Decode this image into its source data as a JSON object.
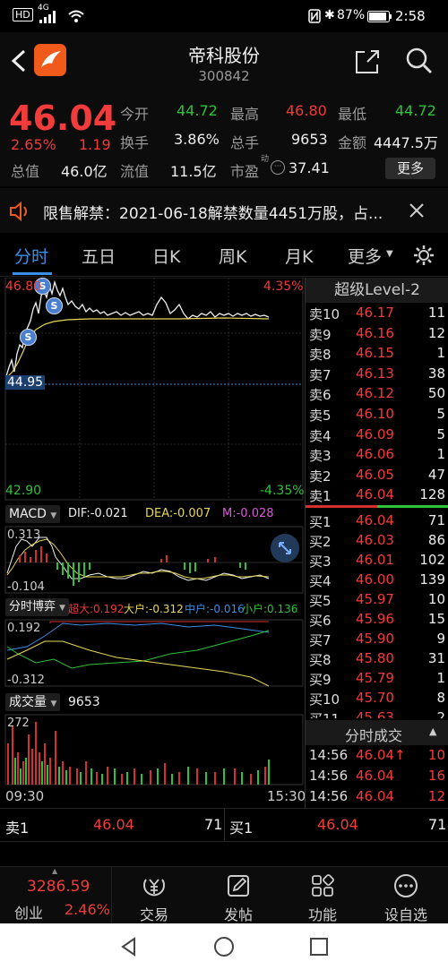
{
  "status_bar": {
    "carrier_hd": "HD",
    "signal": "4G",
    "battery": "87%",
    "time": "2:58"
  },
  "header": {
    "stock_name": "帝科股份",
    "stock_code": "300842"
  },
  "quote": {
    "price": "46.04",
    "change_pct": "2.65%",
    "change_amt": "1.19",
    "open_label": "今开",
    "open": "44.72",
    "high_label": "最高",
    "high": "46.80",
    "low_label": "最低",
    "low": "44.72",
    "turnover_label": "换手",
    "turnover": "3.86%",
    "volume_label": "总手",
    "volume": "9653",
    "amount_label": "金额",
    "amount": "4447.5万",
    "mktcap_label": "总值",
    "mktcap": "46.0亿",
    "float_label": "流值",
    "float_cap": "11.5亿",
    "pe_label": "市盈",
    "pe_sup": "动",
    "pe": "37.41",
    "more_label": "更多"
  },
  "notice": {
    "text": "限售解禁：2021-06-18解禁数量4451万股，占..."
  },
  "tabs": [
    "分时",
    "五日",
    "日K",
    "周K",
    "月K",
    "更多"
  ],
  "chart": {
    "high_price": "46.80",
    "high_pct": "4.35%",
    "low_price": "42.90",
    "low_pct": "-4.35%",
    "avg_line_price": "44.95",
    "macd": {
      "title": "MACD",
      "dif": "DIF:-0.021",
      "dea": "DEA:-0.007",
      "m": "M:-0.028",
      "top": "0.313",
      "bottom": "-0.104"
    },
    "flow": {
      "title": "分时博弈",
      "super": "超大:0.192",
      "large": "大户:-0.312",
      "mid": "中户:-0.016",
      "small": "小户:0.136",
      "top": "0.192",
      "bottom": "-0.312"
    },
    "volume": {
      "title": "成交量",
      "value": "9653",
      "top": "272"
    },
    "time_start": "09:30",
    "time_end": "15:30",
    "markers": [
      "S",
      "S",
      "S"
    ]
  },
  "level2": {
    "title": "超级Level-2",
    "asks": [
      {
        "label": "卖10",
        "price": "46.17",
        "qty": "11"
      },
      {
        "label": "卖9",
        "price": "46.16",
        "qty": "12"
      },
      {
        "label": "卖8",
        "price": "46.15",
        "qty": "1"
      },
      {
        "label": "卖7",
        "price": "46.13",
        "qty": "38"
      },
      {
        "label": "卖6",
        "price": "46.12",
        "qty": "50"
      },
      {
        "label": "卖5",
        "price": "46.10",
        "qty": "5"
      },
      {
        "label": "卖4",
        "price": "46.09",
        "qty": "5"
      },
      {
        "label": "卖3",
        "price": "46.06",
        "qty": "1"
      },
      {
        "label": "卖2",
        "price": "46.05",
        "qty": "47"
      },
      {
        "label": "卖1",
        "price": "46.04",
        "qty": "128"
      }
    ],
    "bids": [
      {
        "label": "买1",
        "price": "46.04",
        "qty": "71"
      },
      {
        "label": "买2",
        "price": "46.03",
        "qty": "86"
      },
      {
        "label": "买3",
        "price": "46.01",
        "qty": "102"
      },
      {
        "label": "买4",
        "price": "46.00",
        "qty": "139"
      },
      {
        "label": "买5",
        "price": "45.97",
        "qty": "10"
      },
      {
        "label": "买6",
        "price": "45.96",
        "qty": "15"
      },
      {
        "label": "买7",
        "price": "45.90",
        "qty": "9"
      },
      {
        "label": "买8",
        "price": "45.80",
        "qty": "31"
      },
      {
        "label": "买9",
        "price": "45.79",
        "qty": "1"
      },
      {
        "label": "买10",
        "price": "45.70",
        "qty": "8"
      },
      {
        "label": "买11",
        "price": "45.63",
        "qty": "2"
      }
    ],
    "trades_title": "分时成交",
    "trades": [
      {
        "time": "14:56",
        "price": "46.04↑",
        "qty": "10"
      },
      {
        "time": "14:56",
        "price": "46.04",
        "qty": "16"
      },
      {
        "time": "14:56",
        "price": "46.04",
        "qty": "12"
      }
    ]
  },
  "bottom_quote": {
    "ask_label": "卖1",
    "ask_price": "46.04",
    "ask_qty": "71",
    "bid_label": "买1",
    "bid_price": "46.04",
    "bid_qty": "71"
  },
  "bottom_nav": {
    "index_value": "3286.59",
    "index_name": "创业",
    "index_pct": "2.46%",
    "items": [
      "交易",
      "发帖",
      "功能",
      "设自选"
    ]
  },
  "colors": {
    "up": "#f23b3b",
    "down": "#2fc13a",
    "accent": "#2a8de8"
  }
}
